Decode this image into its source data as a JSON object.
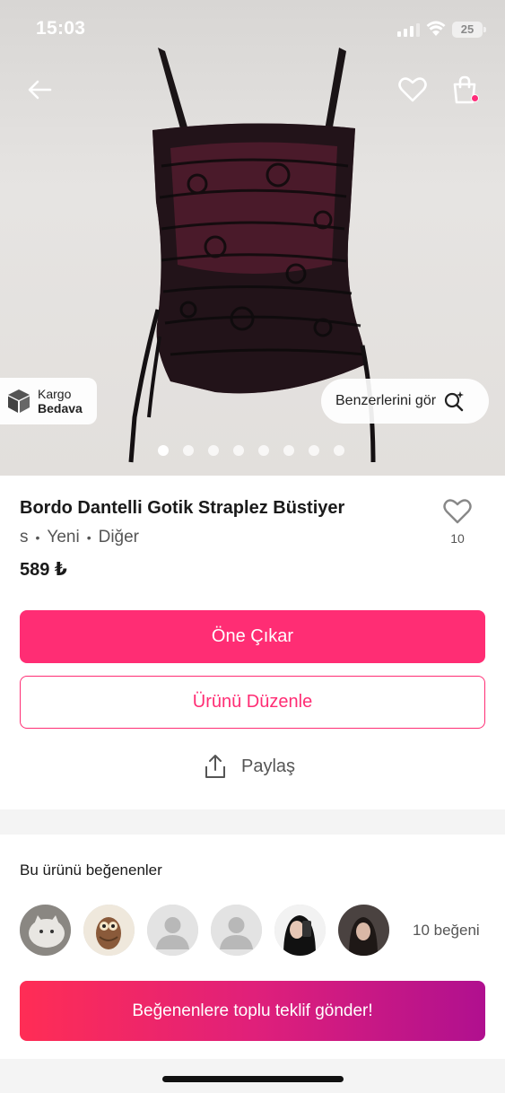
{
  "status_bar": {
    "time": "15:03",
    "battery": "25"
  },
  "hero": {
    "cargo_line1": "Kargo",
    "cargo_line2": "Bedava",
    "similar_label": "Benzerlerini gör",
    "image_count": 8,
    "active_image": 1
  },
  "product": {
    "title": "Bordo Dantelli Gotik Straplez Büstiyer",
    "size": "s",
    "condition": "Yeni",
    "brand": "Diğer",
    "price": "589 ₺",
    "like_count": "10"
  },
  "actions": {
    "boost_label": "Öne Çıkar",
    "edit_label": "Ürünü Düzenle",
    "share_label": "Paylaş"
  },
  "likers": {
    "title": "Bu ürünü beğenenler",
    "count_label": "10 beğeni",
    "avatar_kinds": [
      "cat-photo",
      "owl-photo",
      "default-avatar",
      "default-avatar",
      "person-photo",
      "person-photo"
    ]
  },
  "offer": {
    "label": "Beğenenlere toplu teklif gönder!"
  },
  "colors": {
    "accent": "#ff2d74",
    "gradient_start": "#ff2d55",
    "gradient_end": "#b0108f"
  }
}
